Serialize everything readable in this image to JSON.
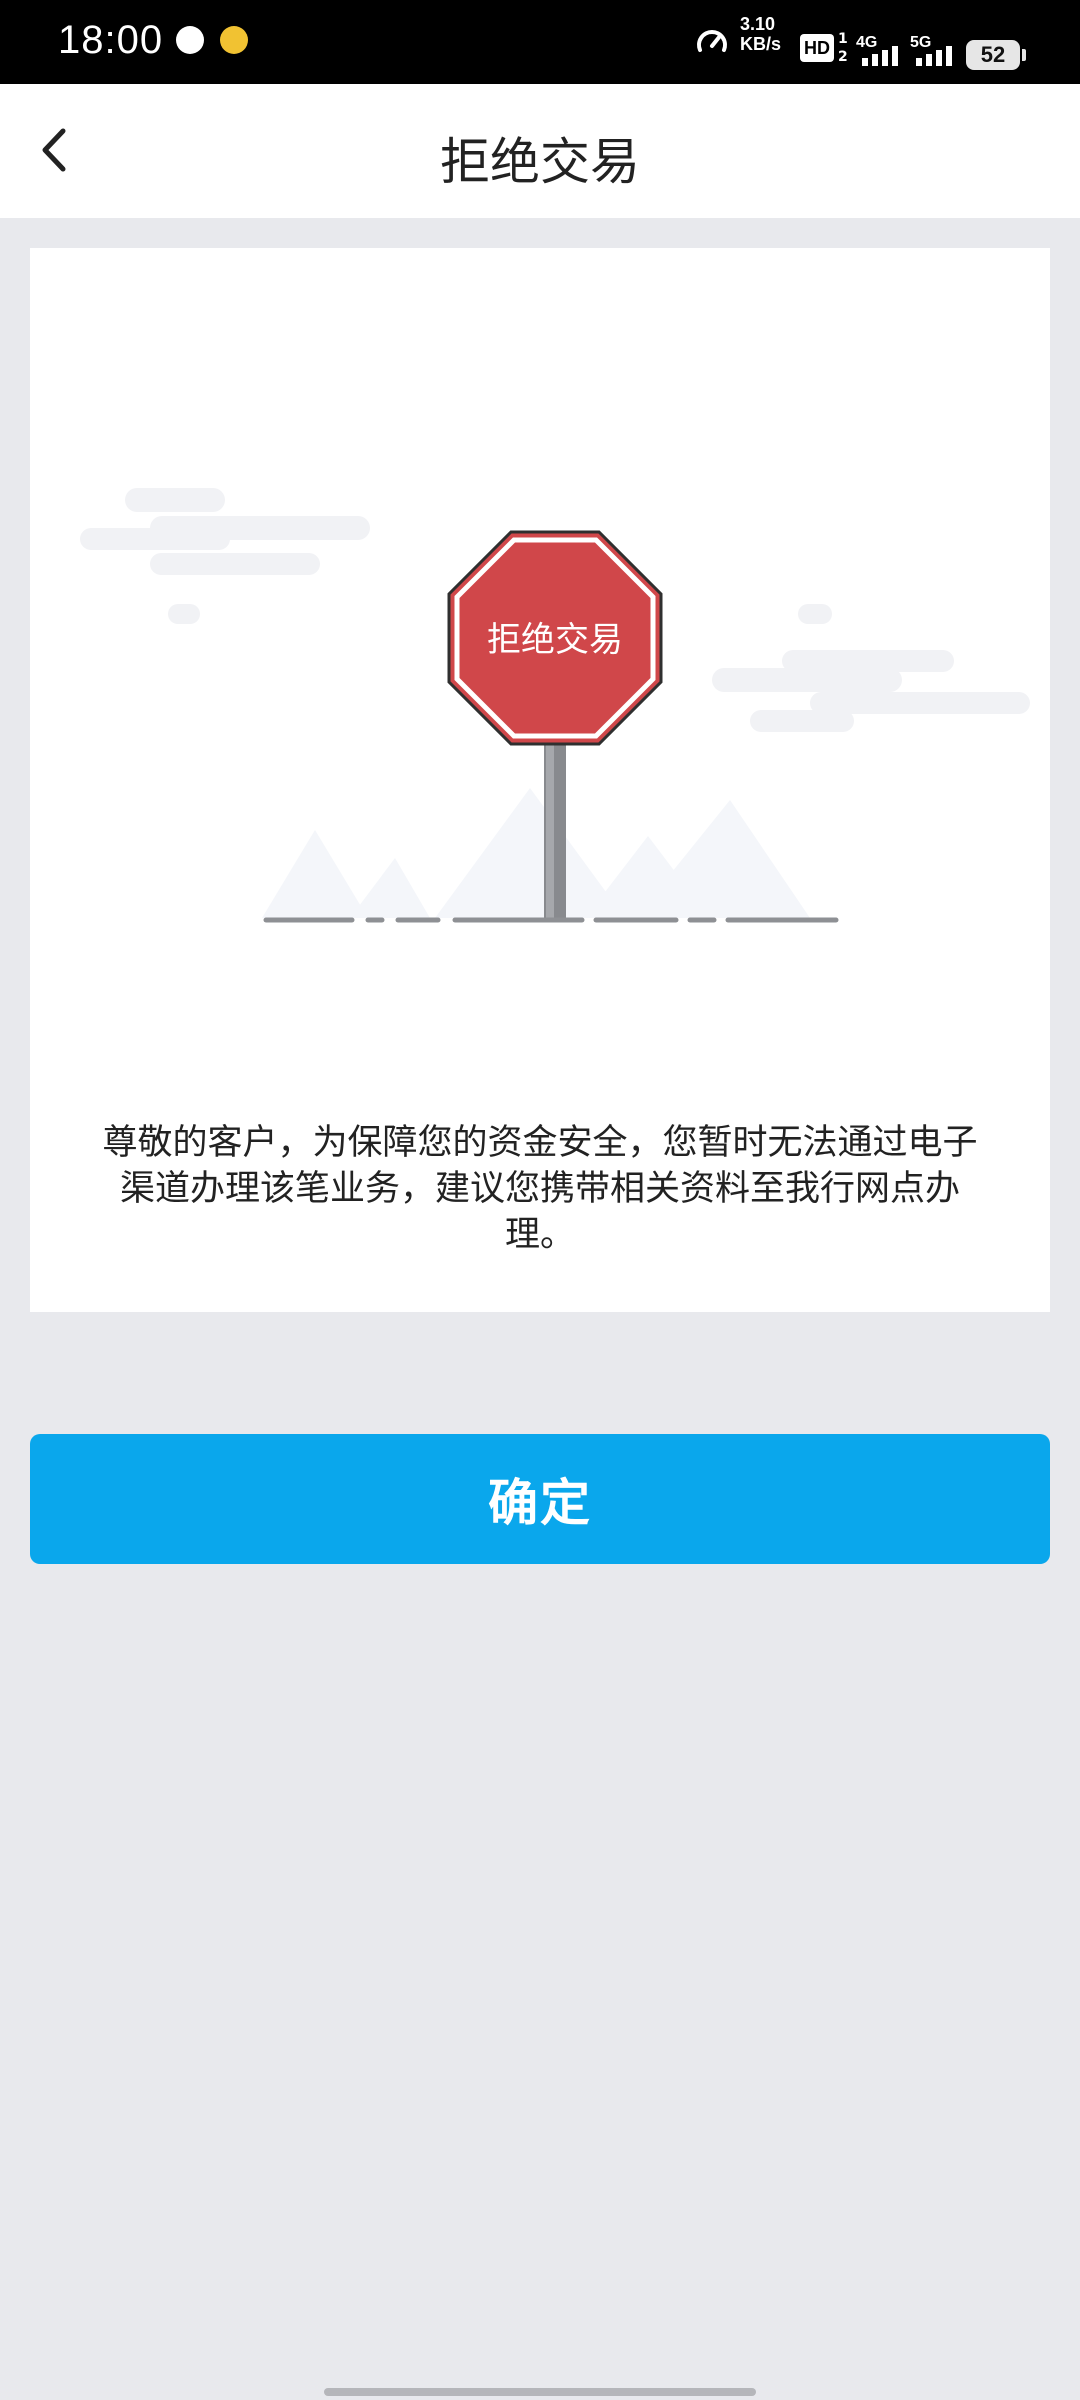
{
  "status_bar": {
    "time": "18:00",
    "speed_value": "3.10",
    "speed_unit": "KB/s",
    "hd_label": "HD",
    "hd_sub": "1\n2",
    "network_1": "4G",
    "network_2": "5G",
    "battery": "52"
  },
  "header": {
    "title": "拒绝交易"
  },
  "card": {
    "sign_text": "拒绝交易",
    "message": "尊敬的客户，为保障您的资金安全，您暂时无法通过电子渠道办理该笔业务，建议您携带相关资料至我行网点办理。"
  },
  "actions": {
    "confirm_label": "确定"
  },
  "colors": {
    "accent": "#0aa7ec",
    "background": "#e8e9ed",
    "sign_red": "#d0474a"
  },
  "icons": {
    "back": "chevron-left-icon",
    "stop_sign": "stop-sign-icon"
  }
}
